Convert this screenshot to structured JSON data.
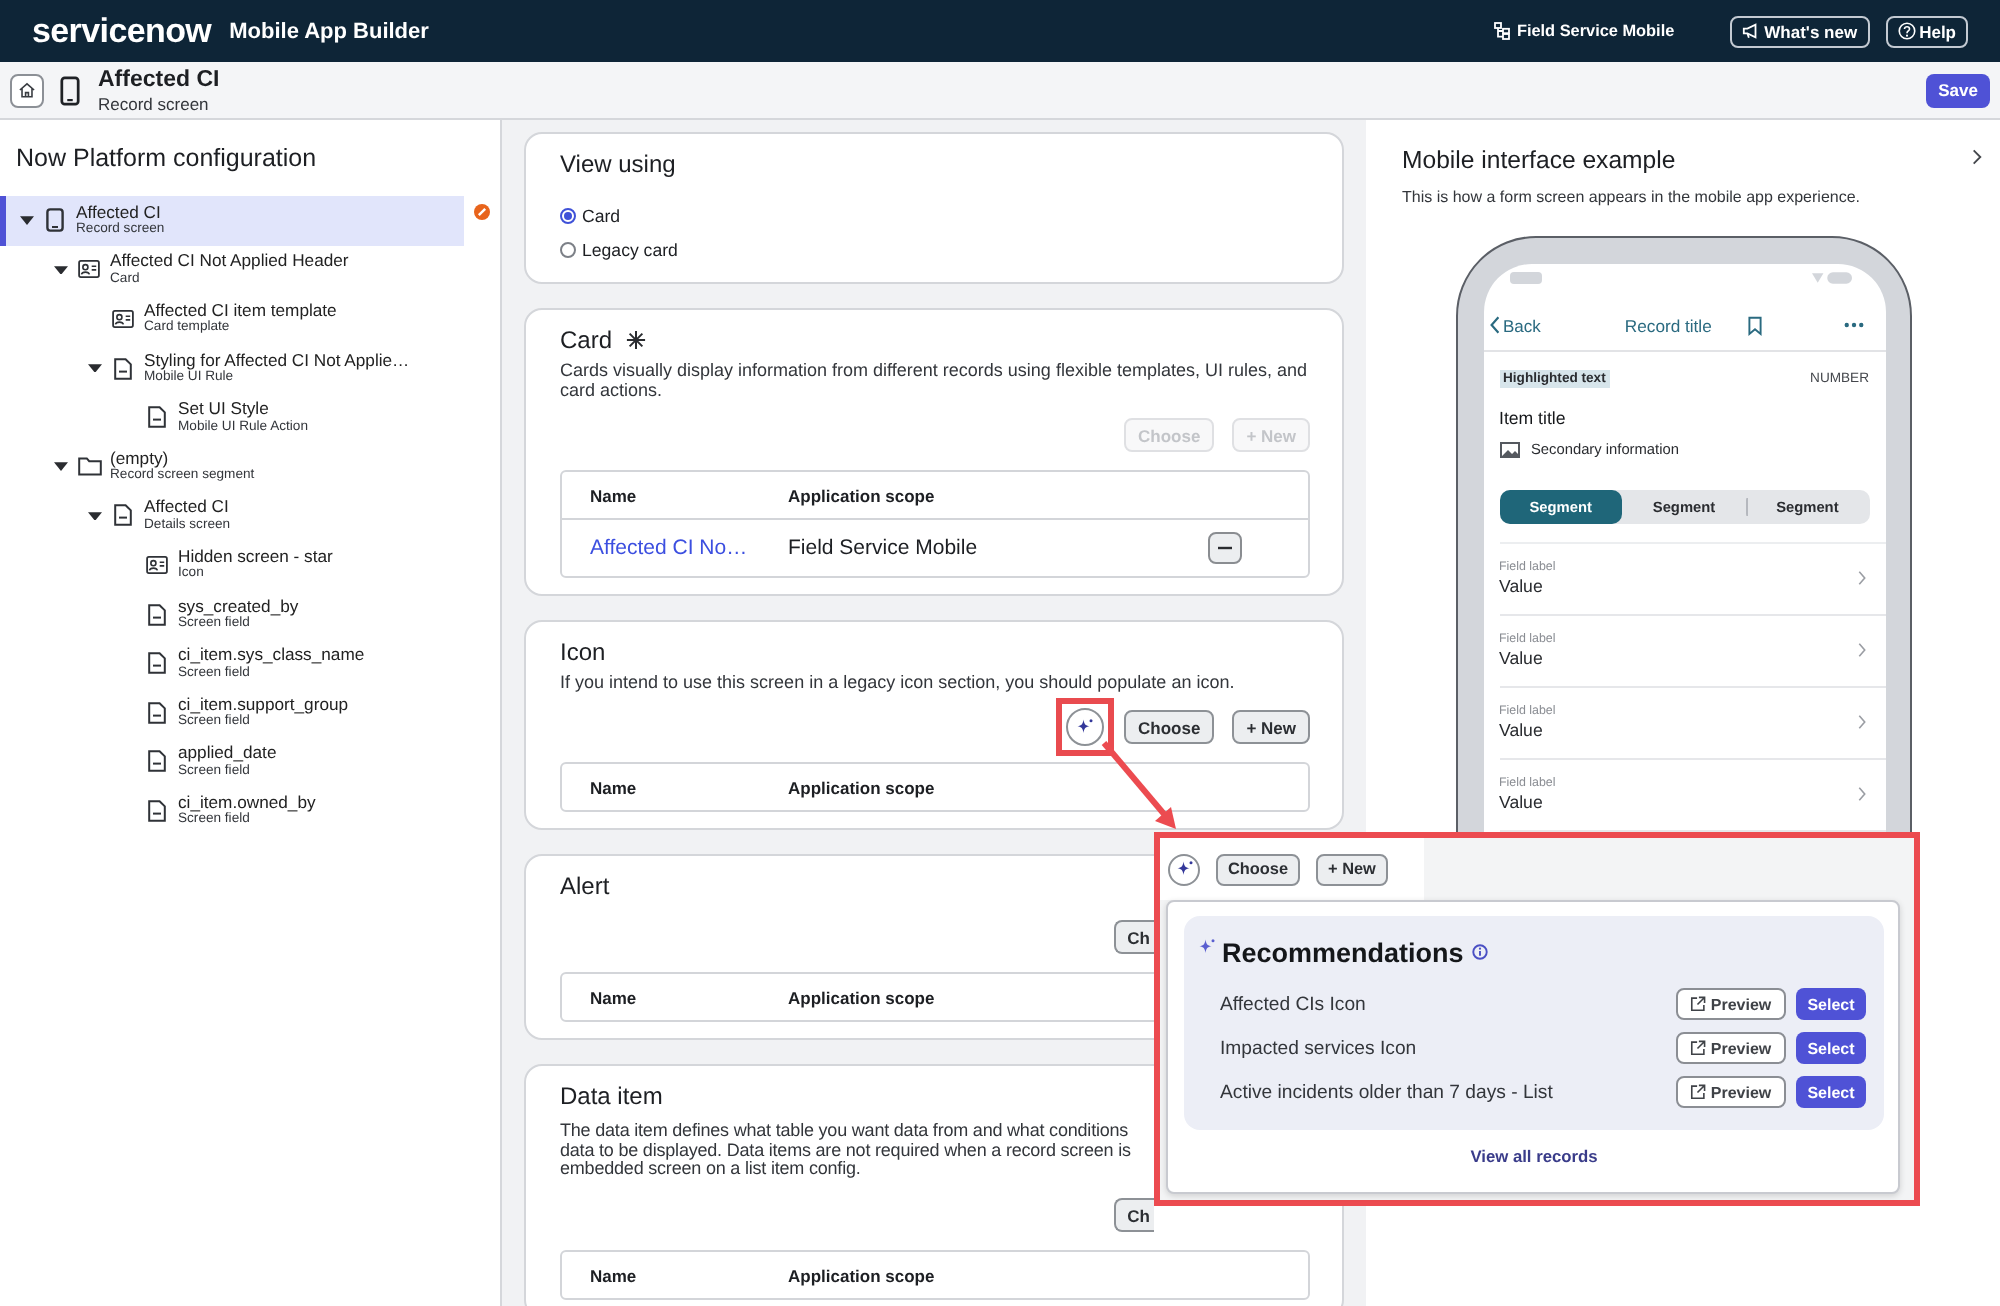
{
  "header": {
    "logo": "servicenow",
    "product": "Mobile App Builder",
    "app_scope": "Field Service Mobile",
    "buttons": [
      {
        "kind": "whats-new",
        "label": "What's new"
      },
      {
        "kind": "help",
        "label": "Help"
      }
    ]
  },
  "screen_bar": {
    "title": "Affected CI",
    "subtitle": "Record screen",
    "save": "Save"
  },
  "config_panel": {
    "title": "Now Platform configuration",
    "tree": [
      {
        "title": "Affected CI",
        "subtitle": "Record screen",
        "kind": "device",
        "selected": true,
        "flagged": true,
        "expanded": true,
        "children": [
          {
            "title": "Affected CI Not Applied Header",
            "subtitle": "Card",
            "kind": "card",
            "selected": false,
            "flagged": false,
            "expanded": true,
            "children": [
              {
                "title": "Affected CI item template",
                "subtitle": "Card template",
                "kind": "card",
                "selected": false,
                "flagged": false
              },
              {
                "title": "Styling for Affected CI Not Applie…",
                "subtitle": "Mobile UI Rule",
                "kind": "document",
                "selected": false,
                "flagged": false,
                "expanded": true,
                "children": [
                  {
                    "title": "Set UI Style",
                    "subtitle": "Mobile UI Rule Action",
                    "kind": "document",
                    "selected": false,
                    "flagged": false
                  }
                ]
              }
            ]
          },
          {
            "title": "(empty)",
            "subtitle": "Record screen segment",
            "kind": "folder",
            "selected": false,
            "flagged": false,
            "expanded": true,
            "children": [
              {
                "title": "Affected CI",
                "subtitle": "Details screen",
                "kind": "document",
                "selected": false,
                "flagged": false,
                "expanded": true,
                "children": [
                  {
                    "title": "Hidden screen - star",
                    "subtitle": "Icon",
                    "kind": "card",
                    "selected": false,
                    "flagged": false
                  },
                  {
                    "title": "sys_created_by",
                    "subtitle": "Screen field",
                    "kind": "document",
                    "selected": false,
                    "flagged": false
                  },
                  {
                    "title": "ci_item.sys_class_name",
                    "subtitle": "Screen field",
                    "kind": "document",
                    "selected": false,
                    "flagged": false
                  },
                  {
                    "title": "ci_item.support_group",
                    "subtitle": "Screen field",
                    "kind": "document",
                    "selected": false,
                    "flagged": false
                  },
                  {
                    "title": "applied_date",
                    "subtitle": "Screen field",
                    "kind": "document",
                    "selected": false,
                    "flagged": false
                  },
                  {
                    "title": "ci_item.owned_by",
                    "subtitle": "Screen field",
                    "kind": "document",
                    "selected": false,
                    "flagged": false
                  }
                ]
              }
            ]
          }
        ]
      }
    ]
  },
  "sections": [
    {
      "kind": "options",
      "title": "View using",
      "required": false,
      "options": [
        {
          "label": "Card",
          "selected": true
        },
        {
          "label": "Legacy card",
          "selected": false
        }
      ]
    },
    {
      "kind": "records",
      "title": "Card",
      "required": true,
      "description": "Cards visually display information from different records using flexible templates, UI rules, and card actions.",
      "buttons": [
        {
          "kind": "text",
          "label": "Choose",
          "disabled": true
        },
        {
          "kind": "text",
          "label": "+ New",
          "disabled": true
        }
      ],
      "table": {
        "columns": [
          "Name",
          "Application scope"
        ],
        "rows": [
          {
            "name": "Affected CI No…",
            "scope": "Field Service Mobile"
          }
        ]
      }
    },
    {
      "kind": "records",
      "title": "Icon",
      "required": false,
      "description": "If you intend to use this screen in a legacy icon section, you should populate an icon.",
      "buttons": [
        {
          "kind": "ai",
          "highlighted": true,
          "disabled": false
        },
        {
          "kind": "text",
          "label": "Choose",
          "disabled": false
        },
        {
          "kind": "text",
          "label": "+ New",
          "disabled": false
        }
      ],
      "table": {
        "columns": [
          "Name",
          "Application scope"
        ]
      }
    },
    {
      "kind": "records",
      "title": "Alert",
      "required": false,
      "buttons": [
        {
          "kind": "covered",
          "label": "Ch",
          "disabled": false
        }
      ],
      "table": {
        "columns": [
          "Name",
          "Application scope"
        ]
      }
    },
    {
      "kind": "records",
      "title": "Data item",
      "required": false,
      "description_lines": [
        "The data item defines what table you want data from and what conditions",
        "data to be displayed. Data items are not required when a record screen is",
        "embedded screen on a list item config."
      ],
      "buttons": [
        {
          "kind": "covered",
          "label": "Ch",
          "disabled": false
        }
      ],
      "table": {
        "columns": [
          "Name",
          "Application scope"
        ]
      }
    }
  ],
  "preview": {
    "title": "Mobile interface example",
    "description": "This is how a form screen appears in the mobile app experience.",
    "phone": {
      "back": "Back",
      "title": "Record title",
      "tag": "Highlighted text",
      "number": "NUMBER",
      "item_title": "Item title",
      "secondary": "Secondary information",
      "segments": [
        {
          "label": "Segment",
          "selected": true
        },
        {
          "label": "Segment",
          "selected": false
        },
        {
          "label": "Segment",
          "selected": false
        }
      ],
      "fields": [
        {
          "label": "Field label",
          "value": "Value"
        },
        {
          "label": "Field label",
          "value": "Value"
        },
        {
          "label": "Field label",
          "value": "Value"
        },
        {
          "label": "Field label",
          "value": "Value"
        }
      ]
    }
  },
  "recommendation_callout": {
    "buttons": [
      {
        "kind": "ai"
      },
      {
        "kind": "text",
        "label": "Choose"
      },
      {
        "kind": "text",
        "label": "+ New"
      }
    ],
    "title": "Recommendations",
    "items": [
      {
        "name": "Affected CIs Icon",
        "preview": "Preview",
        "select": "Select"
      },
      {
        "name": "Impacted services Icon",
        "preview": "Preview",
        "select": "Select"
      },
      {
        "name": "Active incidents older than 7 days - List",
        "preview": "Preview",
        "select": "Select"
      }
    ],
    "link": "View all records"
  }
}
